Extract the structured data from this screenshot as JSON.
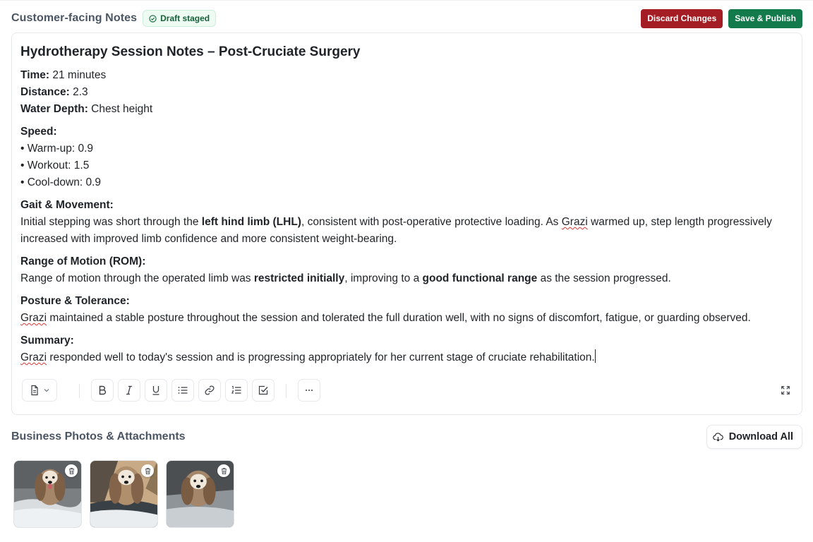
{
  "header": {
    "title": "Customer-facing Notes",
    "badge": "Draft staged",
    "discard_label": "Discard Changes",
    "publish_label": "Save & Publish"
  },
  "note": {
    "title": "Hydrotherapy Session Notes – Post-Cruciate Surgery",
    "time_label": "Time:",
    "time_value": " 21 minutes",
    "distance_label": "Distance:",
    "distance_value": " 2.3",
    "depth_label": "Water Depth:",
    "depth_value": " Chest height",
    "speed_heading": "Speed:",
    "speed_items": [
      "• Warm-up: 0.9",
      "• Workout: 1.5",
      "• Cool-down: 0.9"
    ],
    "gait_heading": "Gait & Movement:",
    "gait_p1": "Initial stepping was short through the ",
    "gait_b1": "left hind limb (LHL)",
    "gait_p2": ", consistent with post-operative protective loading. As ",
    "gait_name": "Grazi",
    "gait_p3": " warmed up, step length progressively increased with improved limb confidence and more consistent weight-bearing.",
    "rom_heading": "Range of Motion (ROM):",
    "rom_p1": "Range of motion through the operated limb was ",
    "rom_b1": "restricted initially",
    "rom_p2": ", improving to a ",
    "rom_b2": "good functional range",
    "rom_p3": " as the session progressed.",
    "posture_heading": "Posture & Tolerance:",
    "posture_name": "Grazi",
    "posture_text": " maintained a stable posture throughout the session and tolerated the full duration well, with no signs of discomfort, fatigue, or guarding observed.",
    "summary_heading": "Summary:",
    "summary_name": "Grazi",
    "summary_text": " responded well to today's session and is progressing appropriately for her current stage of cruciate rehabilitation."
  },
  "toolbar": {
    "items": [
      "document-icon",
      "bold-icon",
      "italic-icon",
      "underline-icon",
      "bullet-list-icon",
      "link-icon",
      "numbered-list-icon",
      "checklist-icon",
      "more-icon",
      "expand-icon"
    ]
  },
  "attachments": {
    "title": "Business Photos & Attachments",
    "download_label": "Download All",
    "photos": [
      "dog-photo-1",
      "dog-photo-2",
      "dog-photo-3"
    ]
  },
  "colors": {
    "discard": "#a51d24",
    "publish": "#137a4b",
    "badge_bg": "#eefbf3",
    "badge_text": "#17603a"
  }
}
